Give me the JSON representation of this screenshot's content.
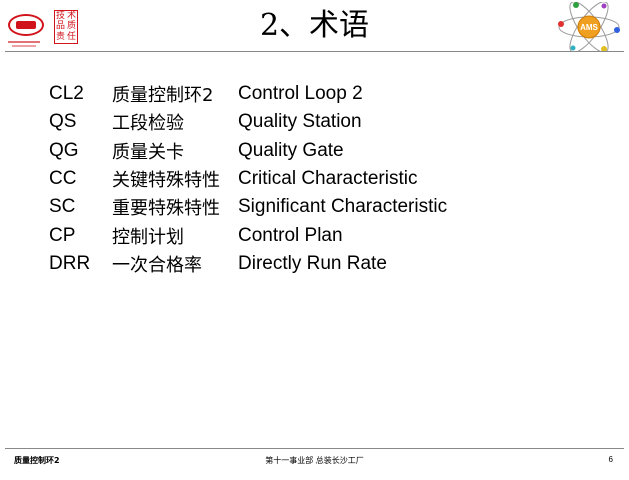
{
  "header": {
    "title": "2、术语",
    "seal_chars": [
      "技",
      "术",
      "品",
      "质",
      "责",
      "任"
    ],
    "ams_label": "AMS"
  },
  "terms": [
    {
      "abbr": "CL2",
      "zh": "质量控制环2",
      "en": "Control Loop 2"
    },
    {
      "abbr": "QS",
      "zh": "工段检验",
      "en": "Quality Station"
    },
    {
      "abbr": "QG",
      "zh": "质量关卡",
      "en": "Quality Gate"
    },
    {
      "abbr": "CC",
      "zh": "关键特殊特性",
      "en": "Critical Characteristic"
    },
    {
      "abbr": "SC",
      "zh": "重要特殊特性",
      "en": "Significant Characteristic"
    },
    {
      "abbr": "CP",
      "zh": "控制计划",
      "en": "Control Plan"
    },
    {
      "abbr": "DRR",
      "zh": "一次合格率",
      "en": "Directly Run Rate"
    }
  ],
  "footer": {
    "left": "质量控制环2",
    "center": "第十一事业部 总装长沙工厂",
    "page": "6"
  },
  "colors": {
    "brand_red": "#d1141b",
    "rule": "#888888"
  }
}
